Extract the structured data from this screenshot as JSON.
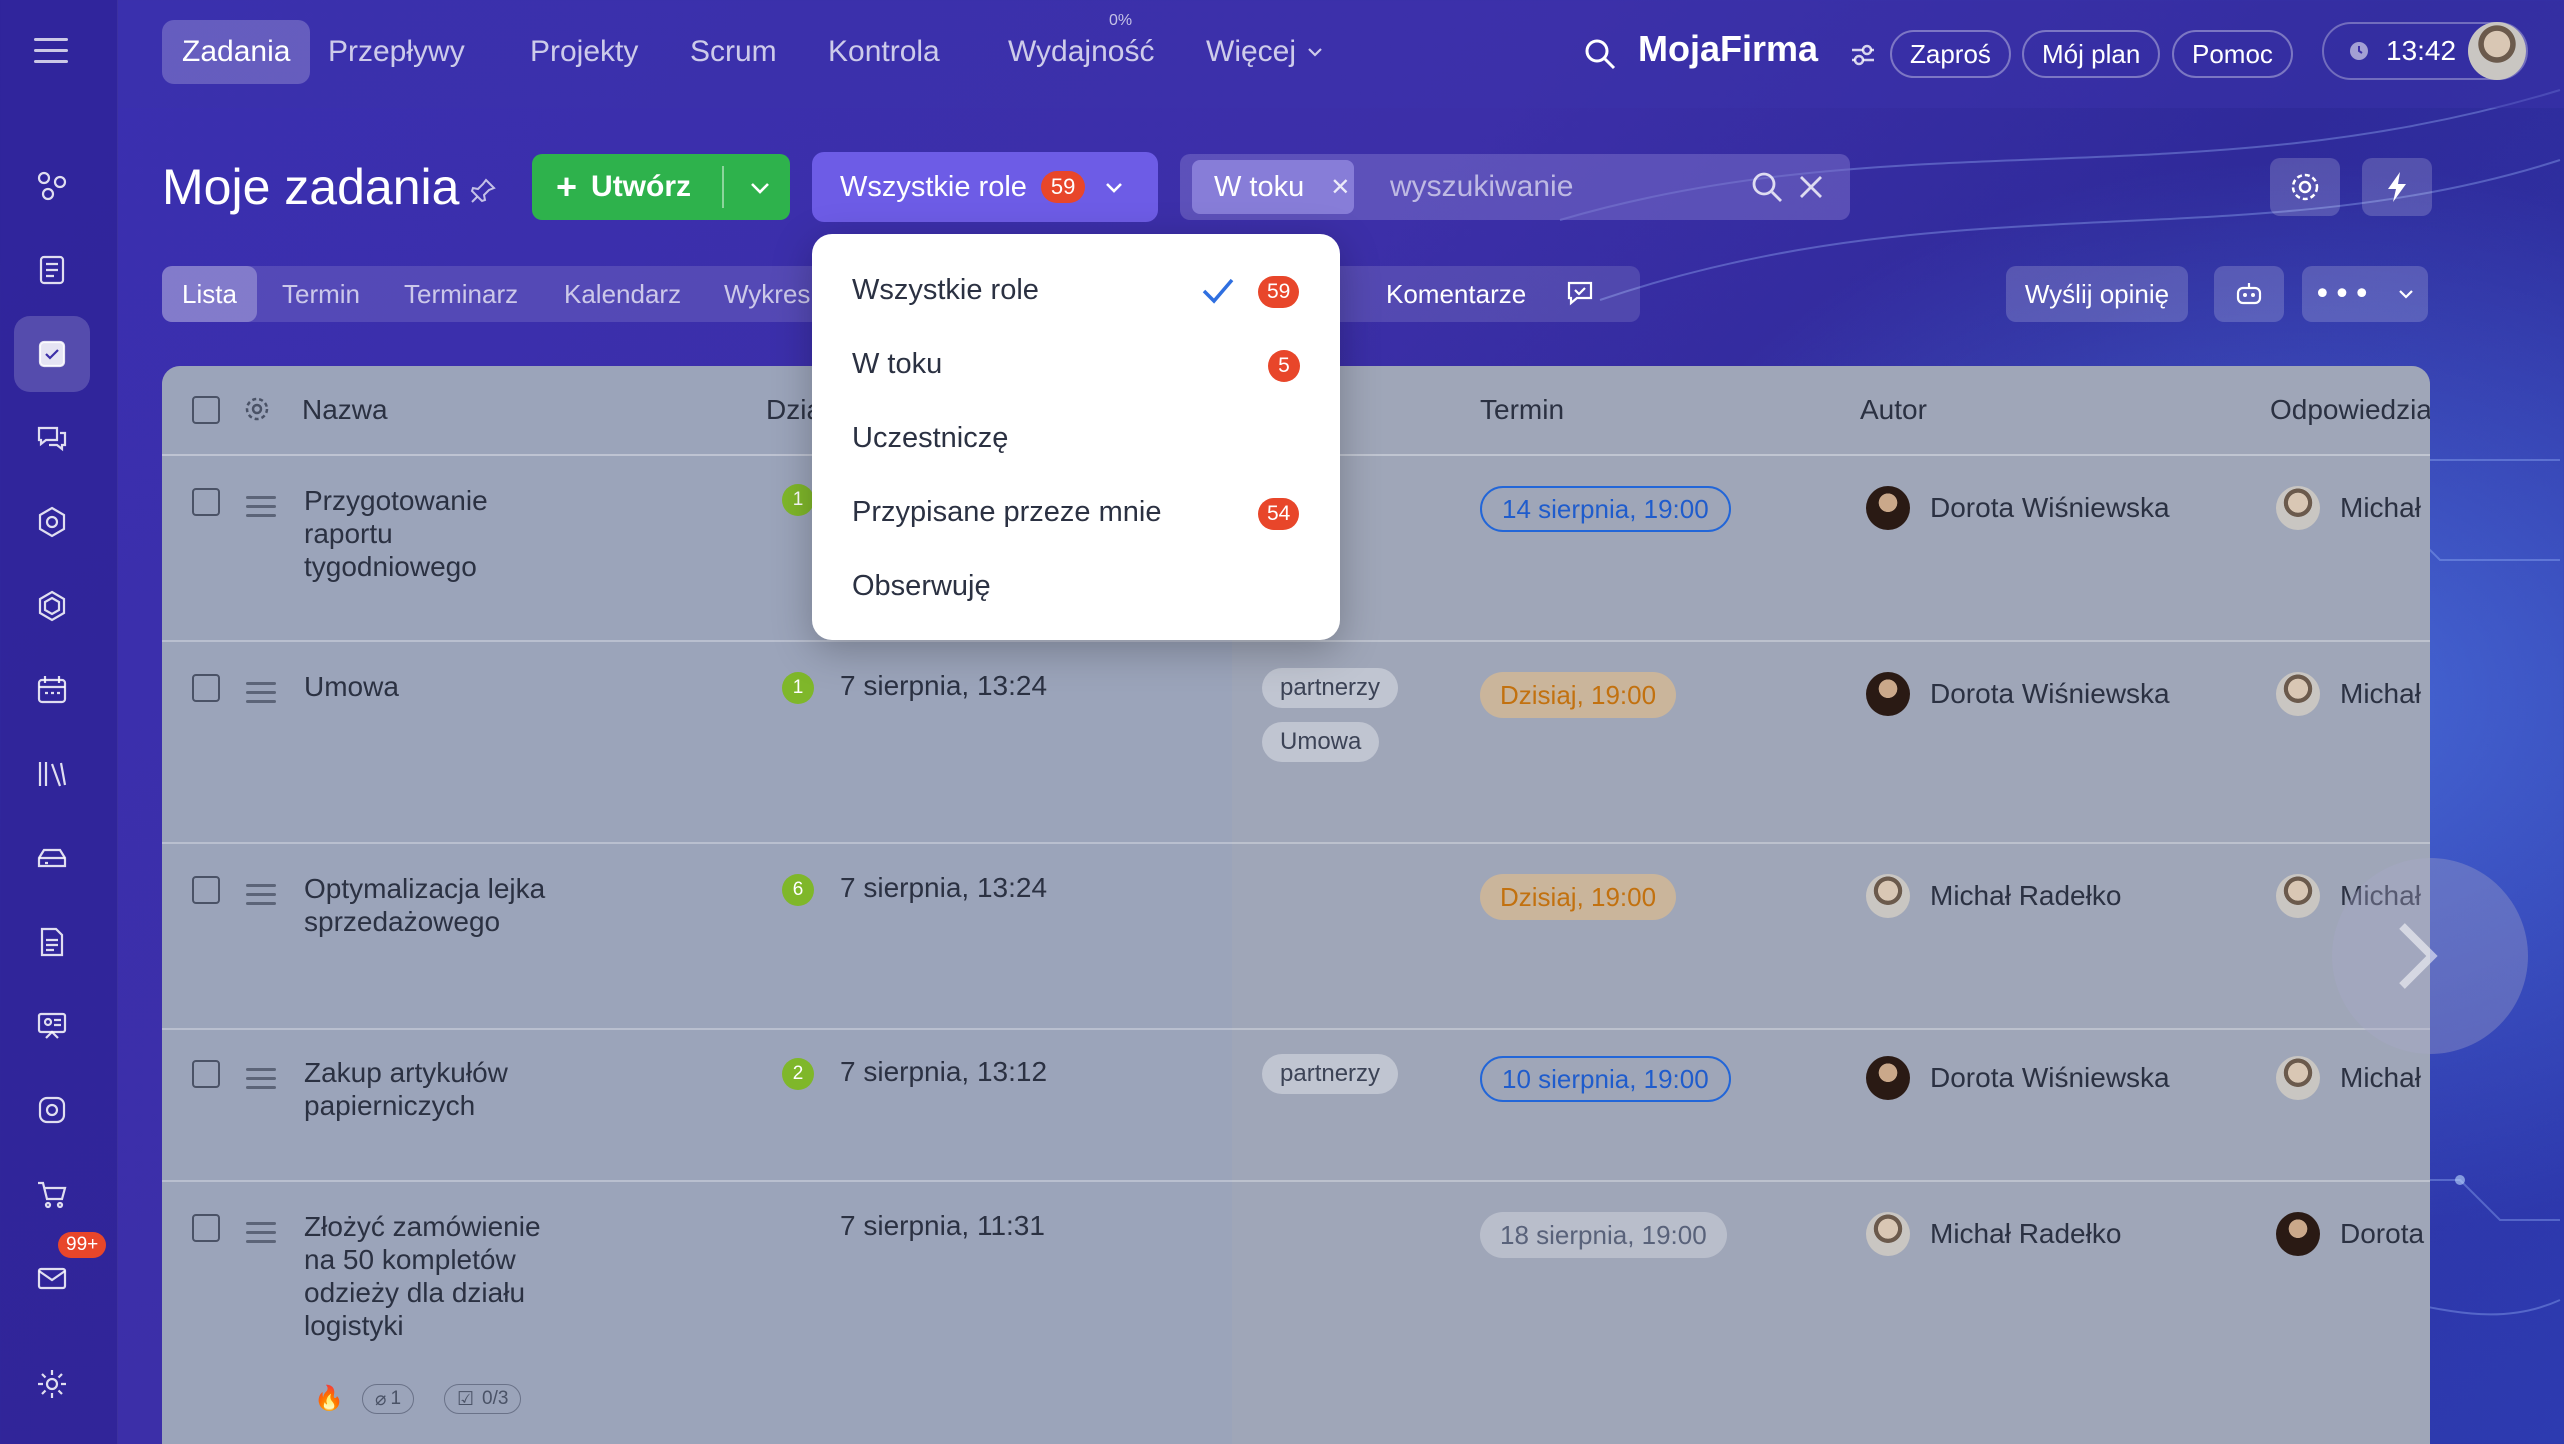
{
  "nav": {
    "items": [
      "Zadania",
      "Przepływy",
      "Projekty",
      "Scrum",
      "Kontrola",
      "Wydajność",
      "Więcej"
    ],
    "performance_percent": "0%",
    "brand": "MojaFirma",
    "invite": "Zaproś",
    "my_plan": "Mój plan",
    "help": "Pomoc",
    "time": "13:42"
  },
  "sidebar": {
    "mail_badge": "99+"
  },
  "header": {
    "title": "Moje zadania",
    "create_label": "Utwórz",
    "roles_button": "Wszystkie role",
    "roles_count": "59",
    "filter_chip": "W toku",
    "search_placeholder": "wyszukiwanie"
  },
  "tabs": [
    "Lista",
    "Termin",
    "Terminarz",
    "Kalendarz",
    "Wykres"
  ],
  "comments_label": "Komentarze",
  "feedback_label": "Wyślij opinię",
  "table": {
    "headers": {
      "name": "Nazwa",
      "activity": "Dzia",
      "deadline": "Termin",
      "author": "Autor",
      "responsible": "Odpowiedzia"
    },
    "rows": [
      {
        "name": "Przygotowanie raportu tygodniowego",
        "count": "1",
        "date": "",
        "tags": [],
        "deadline": "14 sierpnia, 19:00",
        "author": "Dorota Wiśniewska",
        "responsible": "Michał"
      },
      {
        "name": "Umowa",
        "count": "1",
        "date": "7 sierpnia, 13:24",
        "tags": [
          "partnerzy",
          "Umowa"
        ],
        "deadline": "Dzisiaj, 19:00",
        "author": "Dorota Wiśniewska",
        "responsible": "Michał"
      },
      {
        "name": "Optymalizacja lejka sprzedażowego",
        "count": "6",
        "date": "7 sierpnia, 13:24",
        "tags": [],
        "deadline": "Dzisiaj, 19:00",
        "author": "Michał Radełko",
        "responsible": "Michał"
      },
      {
        "name": "Zakup artykułów papierniczych",
        "count": "2",
        "date": "7 sierpnia, 13:12",
        "tags": [
          "partnerzy"
        ],
        "deadline": "10 sierpnia, 19:00",
        "author": "Dorota Wiśniewska",
        "responsible": "Michał"
      },
      {
        "name": "Złożyć zamówienie na 50 kompletów odzieży dla działu logistyki",
        "count": "",
        "date": "7 sierpnia, 11:31",
        "tags": [],
        "deadline": "18 sierpnia, 19:00",
        "author": "Michał Radełko",
        "responsible": "Dorota",
        "attachments": "1",
        "checklist": "0/3"
      }
    ]
  },
  "dropdown": {
    "items": [
      {
        "label": "Wszystkie role",
        "count": "59"
      },
      {
        "label": "W toku",
        "count": "5"
      },
      {
        "label": "Uczestniczę",
        "count": ""
      },
      {
        "label": "Przypisane przeze mnie",
        "count": "54"
      },
      {
        "label": "Obserwuję",
        "count": ""
      }
    ]
  }
}
